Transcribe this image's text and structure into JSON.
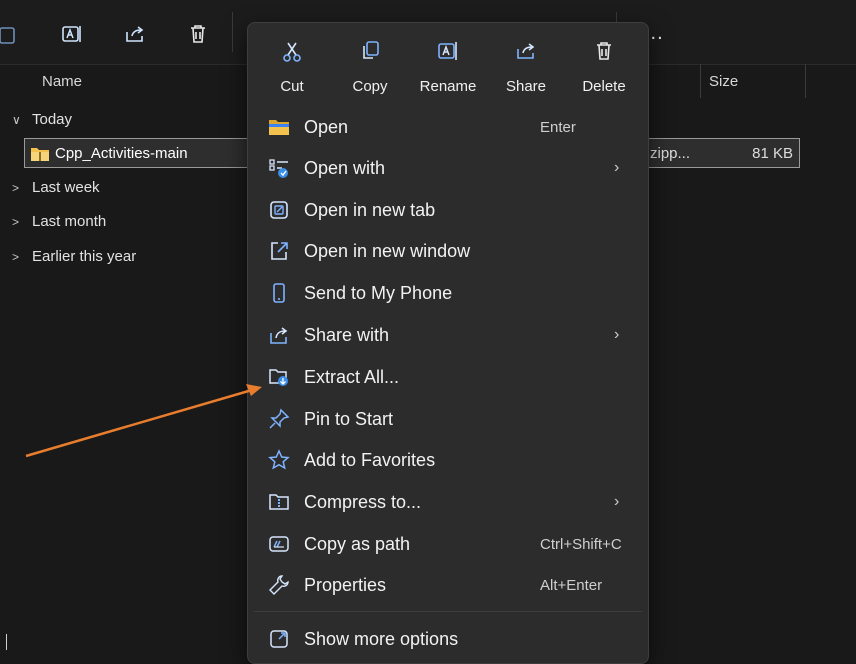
{
  "columns": {
    "name": "Name",
    "size": "Size"
  },
  "groups": {
    "today": "Today",
    "last_week": "Last week",
    "last_month": "Last month",
    "earlier": "Earlier this year"
  },
  "file": {
    "name": "Cpp_Activities-main",
    "type": "zipp...",
    "size": "81 KB"
  },
  "quick_actions": [
    "Cut",
    "Copy",
    "Rename",
    "Share",
    "Delete"
  ],
  "menu": {
    "open": {
      "label": "Open",
      "shortcut": "Enter"
    },
    "open_with": {
      "label": "Open with"
    },
    "open_new_tab": {
      "label": "Open in new tab"
    },
    "open_new_window": {
      "label": "Open in new window"
    },
    "send_phone": {
      "label": "Send to My Phone"
    },
    "share_with": {
      "label": "Share with"
    },
    "extract_all": {
      "label": "Extract All..."
    },
    "pin_start": {
      "label": "Pin to Start"
    },
    "add_favorites": {
      "label": "Add to Favorites"
    },
    "compress": {
      "label": "Compress to..."
    },
    "copy_path": {
      "label": "Copy as path",
      "shortcut": "Ctrl+Shift+C"
    },
    "properties": {
      "label": "Properties",
      "shortcut": "Alt+Enter"
    },
    "show_more": {
      "label": "Show more options"
    },
    "submenu_arrow": "›"
  },
  "toolbar": {
    "more": "..."
  },
  "colors": {
    "annotation_arrow": "#e87d2e",
    "icon_accent": "#7fb3ff",
    "folder": "#f2c14e"
  }
}
